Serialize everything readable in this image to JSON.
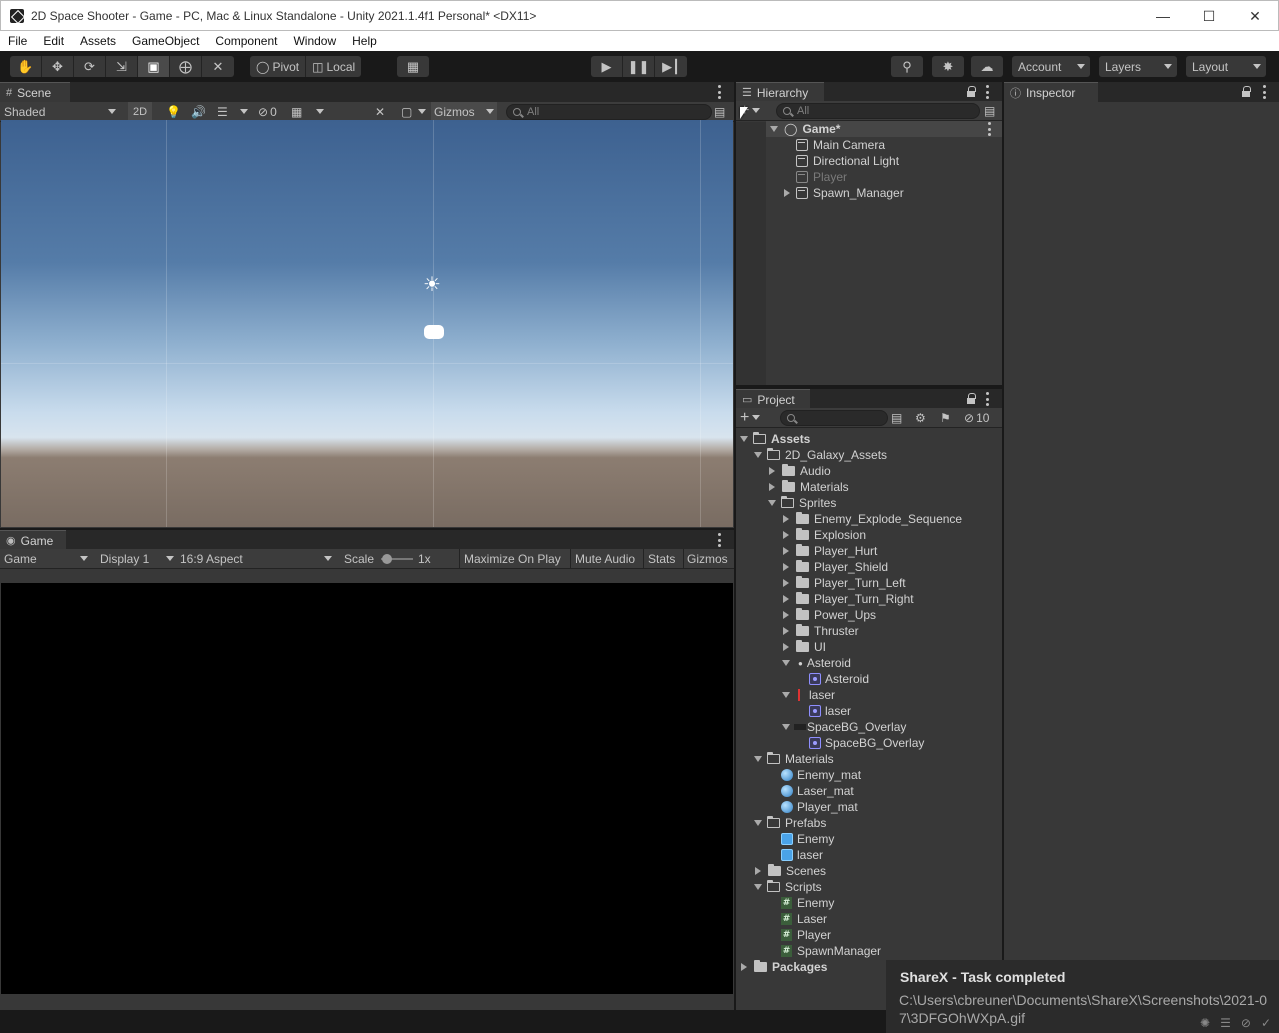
{
  "window": {
    "title": "2D Space Shooter - Game - PC, Mac & Linux Standalone - Unity 2021.1.4f1 Personal* <DX11>",
    "buttons": [
      "minimize-icon",
      "maximize-icon",
      "close-icon"
    ]
  },
  "menu": [
    "File",
    "Edit",
    "Assets",
    "GameObject",
    "Component",
    "Window",
    "Help"
  ],
  "toolbar": {
    "pivot": "Pivot",
    "local": "Local",
    "account": "Account",
    "layers": "Layers",
    "layout": "Layout"
  },
  "scene": {
    "tab": "Scene",
    "shading": "Shaded",
    "mode_2d": "2D",
    "hidden_count": "0",
    "gizmos": "Gizmos",
    "search_placeholder": "All"
  },
  "game": {
    "tab": "Game",
    "view": "Game",
    "display": "Display 1",
    "aspect": "16:9 Aspect",
    "scale_label": "Scale",
    "scale_value": "1x",
    "maximize": "Maximize On Play",
    "mute": "Mute Audio",
    "stats": "Stats",
    "gizmos": "Gizmos"
  },
  "hierarchy": {
    "tab": "Hierarchy",
    "search_placeholder": "All",
    "scene_name": "Game*",
    "objects": [
      {
        "label": "Main Camera"
      },
      {
        "label": "Directional Light"
      },
      {
        "label": "Player"
      },
      {
        "label": "Spawn_Manager"
      }
    ]
  },
  "inspector": {
    "tab": "Inspector"
  },
  "project": {
    "tab": "Project",
    "hidden_count": "10",
    "root": "Assets",
    "galaxy": "2D_Galaxy_Assets",
    "galaxy_children": [
      "Audio",
      "Materials",
      "Sprites"
    ],
    "sprite_folders": [
      "Enemy_Explode_Sequence",
      "Explosion",
      "Player_Hurt",
      "Player_Shield",
      "Player_Turn_Left",
      "Player_Turn_Right",
      "Power_Ups",
      "Thruster",
      "UI"
    ],
    "sprite_assets": [
      {
        "label": "Asteroid",
        "child": "Asteroid"
      },
      {
        "label": "laser",
        "child": "laser"
      },
      {
        "label": "SpaceBG_Overlay",
        "child": "SpaceBG_Overlay"
      }
    ],
    "materials_folder": "Materials",
    "materials": [
      "Enemy_mat",
      "Laser_mat",
      "Player_mat"
    ],
    "prefabs_folder": "Prefabs",
    "prefabs": [
      "Enemy",
      "laser"
    ],
    "scenes_folder": "Scenes",
    "scripts_folder": "Scripts",
    "scripts": [
      "Enemy",
      "Laser",
      "Player",
      "SpawnManager"
    ],
    "packages": "Packages"
  },
  "toast": {
    "title": "ShareX - Task completed",
    "path": "C:\\Users\\cbreuner\\Documents\\ShareX\\Screenshots\\2021-07\\3DFGOhWXpA.gif"
  }
}
